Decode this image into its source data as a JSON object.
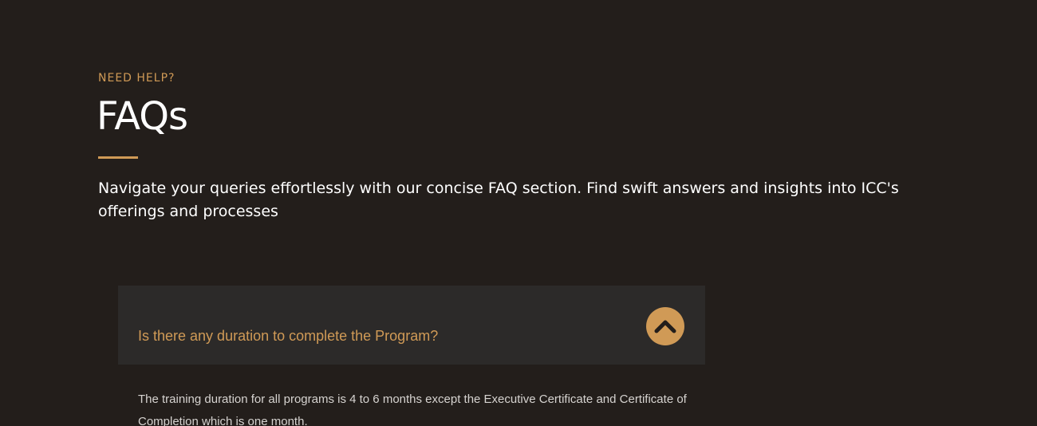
{
  "section": {
    "eyebrow": "NEED HELP?",
    "title": "FAQs",
    "intro": "Navigate your queries effortlessly with our concise FAQ section. Find swift answers and insights into ICC's offerings and processes"
  },
  "faqs": [
    {
      "question": "Is there any duration to complete the Program?",
      "answer": "The training duration for all programs is 4 to 6 months except the Executive Certificate and Certificate of Completion which is one month.",
      "expanded": true,
      "toggle_icon": "chevron-up-icon"
    }
  ],
  "colors": {
    "background": "#231e1b",
    "accent": "#d09a56",
    "card": "#2c2a29",
    "text": "#ffffff",
    "answer_text": "#d6d3d0"
  }
}
